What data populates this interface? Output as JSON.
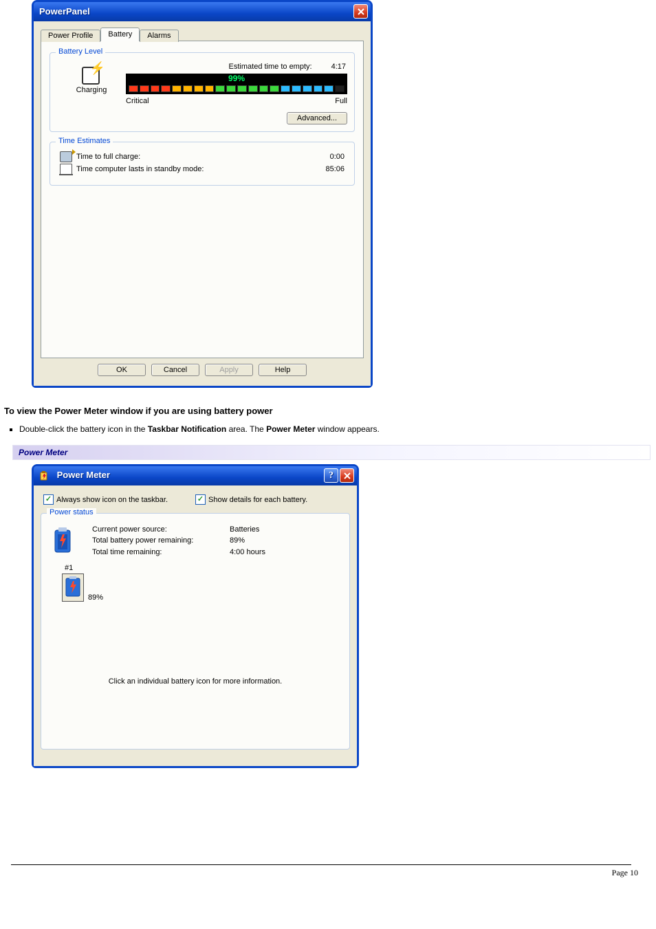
{
  "powerpanel": {
    "title": "PowerPanel",
    "tabs": {
      "profile": "Power Profile",
      "battery": "Battery",
      "alarms": "Alarms"
    },
    "battery_level": {
      "group": "Battery Level",
      "charging": "Charging",
      "est_label": "Estimated time to empty:",
      "est_value": "4:17",
      "percent": "99%",
      "critical": "Critical",
      "full": "Full",
      "advanced": "Advanced..."
    },
    "time_estimates": {
      "group": "Time Estimates",
      "full_charge_label": "Time to full charge:",
      "full_charge_value": "0:00",
      "standby_label": "Time computer lasts in standby mode:",
      "standby_value": "85:06"
    },
    "buttons": {
      "ok": "OK",
      "cancel": "Cancel",
      "apply": "Apply",
      "help": "Help"
    }
  },
  "instructions": {
    "heading": "To view the Power Meter window if you are using battery power",
    "bullet_prefix": "Double-click the battery icon in the ",
    "bold1": "Taskbar Notification",
    "middle": " area. The ",
    "bold2": "Power Meter",
    "suffix": " window appears.",
    "caption": "Power Meter"
  },
  "powermeter": {
    "title": "Power Meter",
    "chk1": "Always show icon on the taskbar.",
    "chk2": "Show details for each battery.",
    "group": "Power status",
    "rows": {
      "r1l": "Current power source:",
      "r1v": "Batteries",
      "r2l": "Total battery power remaining:",
      "r2v": "89%",
      "r3l": "Total time remaining:",
      "r3v": "4:00 hours"
    },
    "slot_num": "#1",
    "slot_pct": "89%",
    "note": "Click an individual battery icon for more information."
  },
  "footer": "Page 10"
}
